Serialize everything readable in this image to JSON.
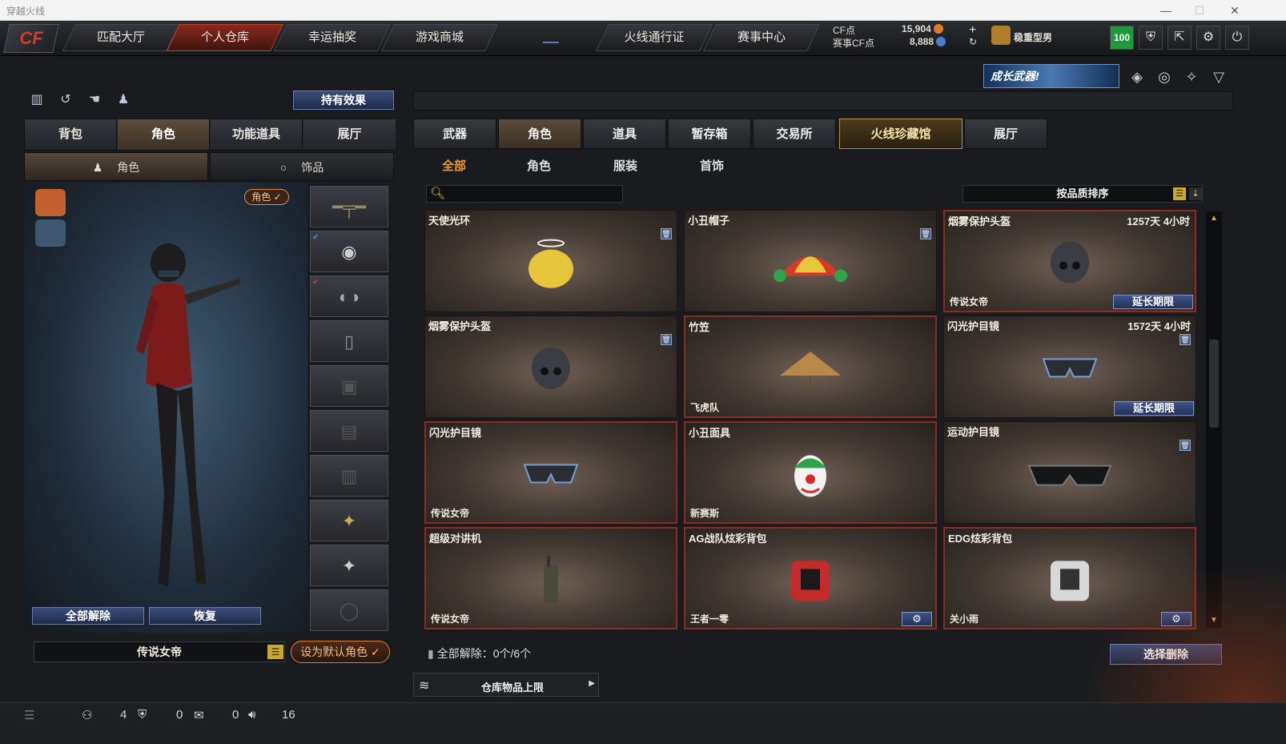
{
  "window": {
    "title": "穿越火线",
    "controls": [
      "—",
      "☐",
      "✕"
    ]
  },
  "nav": {
    "logo": "CF",
    "tabs": [
      "匹配大厅",
      "个人仓库",
      "幸运抽奖",
      "游戏商城",
      "火线通行证",
      "赛事中心"
    ],
    "active_tab": "个人仓库"
  },
  "currency": {
    "cf_label": "CF点",
    "cf_value": "15,904",
    "match_label": "赛事CF点",
    "match_value": "8,888",
    "plus": "+",
    "refresh": "↻"
  },
  "user": {
    "name": "稳重型男",
    "level_badge": "100"
  },
  "banner": {
    "text": "成长武器!"
  },
  "left": {
    "effects_button": "持有效果",
    "tabs": [
      "背包",
      "角色",
      "功能道具",
      "展厅"
    ],
    "active_tab": "角色",
    "subtabs": [
      "角色",
      "饰品"
    ],
    "char_badge": "角色 ✓",
    "unequip_all": "全部解除",
    "restore": "恢复",
    "character_name": "传说女帝",
    "set_default": "设为默认角色 ✓"
  },
  "right": {
    "tabs": [
      "武器",
      "角色",
      "道具",
      "暂存箱",
      "交易所",
      "火线珍藏馆",
      "展厅"
    ],
    "active_tab": "角色",
    "subtabs": [
      "全部",
      "角色",
      "服装",
      "首饰"
    ],
    "active_subtab": "全部",
    "search_placeholder": "",
    "sort_label": "按品质排序",
    "items": [
      {
        "name": "天使光环",
        "time": "",
        "owner": "",
        "action": "delete"
      },
      {
        "name": "小丑帽子",
        "time": "",
        "owner": "",
        "action": "delete"
      },
      {
        "name": "烟雾保护头盔",
        "time": "1257天 4小时",
        "owner": "传说女帝",
        "action": "延长期限"
      },
      {
        "name": "烟雾保护头盔",
        "time": "",
        "owner": "",
        "action": "delete"
      },
      {
        "name": "竹笠",
        "time": "",
        "owner": "飞虎队",
        "action": ""
      },
      {
        "name": "闪光护目镜",
        "time": "1572天 4小时",
        "owner": "",
        "action": "延长期限"
      },
      {
        "name": "闪光护目镜",
        "time": "",
        "owner": "传说女帝",
        "action": ""
      },
      {
        "name": "小丑面具",
        "time": "",
        "owner": "新赛斯",
        "action": ""
      },
      {
        "name": "运动护目镜",
        "time": "",
        "owner": "",
        "action": "delete"
      },
      {
        "name": "超级对讲机",
        "time": "",
        "owner": "传说女帝",
        "action": ""
      },
      {
        "name": "AG战队炫彩背包",
        "time": "",
        "owner": "王者一零",
        "action": "gear"
      },
      {
        "name": "EDG炫彩背包",
        "time": "",
        "owner": "关小雨",
        "action": "gear"
      }
    ],
    "unequip_summary": "全部解除：0个/6个",
    "select_delete": "选择删除",
    "capacity_label": "仓库物品上限"
  },
  "statusbar": {
    "friends": "4",
    "clan": "0",
    "messages": "0",
    "volume": "16"
  },
  "colors": {
    "accent_orange": "#ee9a3a",
    "active_red": "#8b2a1a",
    "button_blue": "#3b4d79",
    "card_red_border": "#8e2b22"
  }
}
